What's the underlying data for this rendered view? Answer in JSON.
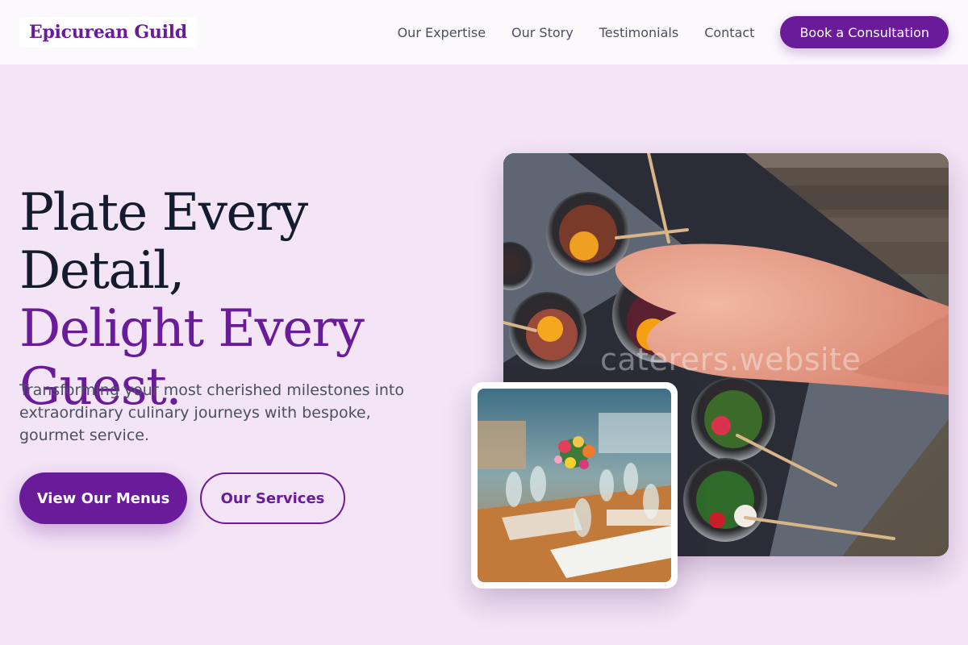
{
  "header": {
    "logo": "Epicurean Guild",
    "nav": [
      {
        "label": "Our Expertise"
      },
      {
        "label": "Our Story"
      },
      {
        "label": "Testimonials"
      },
      {
        "label": "Contact"
      }
    ],
    "cta_label": "Book a Consultation"
  },
  "hero": {
    "title_line1": "Plate Every Detail,",
    "title_line2": "Delight Every Guest.",
    "subtitle": "Transforming your most cherished milestones into extraordinary culinary journeys with bespoke, gourmet service.",
    "primary_button": "View Our Menus",
    "secondary_button": "Our Services"
  },
  "images": {
    "main_alt": "Hand picking up a glass cup of appetizers with skewers",
    "watermark": "caterers.website",
    "inset_alt": "Elegant banquet table with glassware and floral centerpiece"
  },
  "colors": {
    "accent": "#6a1b9a",
    "background": "#f3e4f6",
    "header_bg": "#fcf9fd",
    "heading_dark": "#141b2d",
    "body_text": "#4b5060"
  }
}
